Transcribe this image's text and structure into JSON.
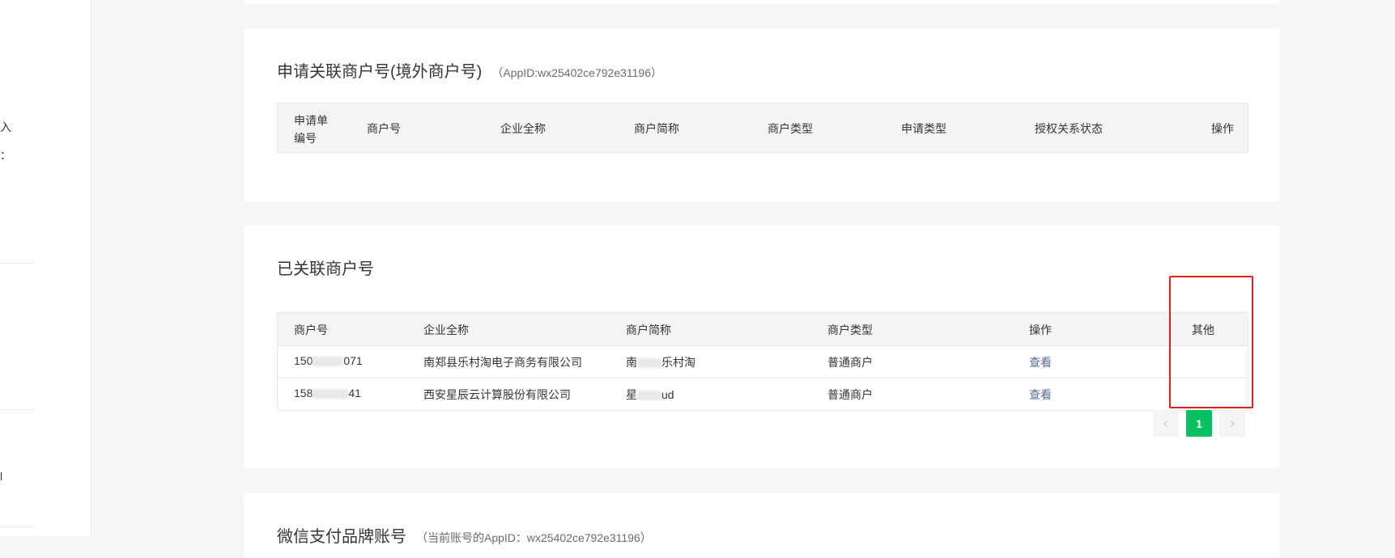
{
  "left_nav": {
    "fragments": [
      "入",
      "：",
      "l"
    ]
  },
  "apply_section": {
    "title": "申请关联商户号(境外商户号)",
    "appid_note": "（AppID:wx25402ce792e31196）",
    "columns": [
      "申请单\n编号",
      "商户号",
      "企业全称",
      "商户简称",
      "商户类型",
      "申请类型",
      "授权关系状态",
      "操作"
    ]
  },
  "linked_section": {
    "title": "已关联商户号",
    "columns": [
      "商户号",
      "企业全称",
      "商户简称",
      "商户类型",
      "操作",
      "其他"
    ],
    "rows": [
      {
        "merchant_id_prefix": "150",
        "merchant_id_suffix": "071",
        "company_name": "南郑县乐村淘电子商务有限公司",
        "short_name_prefix": "南",
        "short_name_suffix": "乐村淘",
        "merchant_type": "普通商户",
        "action": "查看",
        "other": ""
      },
      {
        "merchant_id_prefix": "158",
        "merchant_id_suffix": "41",
        "company_name": "西安星辰云计算股份有限公司",
        "short_name_prefix": "星",
        "short_name_suffix": "ud",
        "merchant_type": "普通商户",
        "action": "查看",
        "other": ""
      }
    ],
    "pagination": {
      "prev_icon": "chevron-left",
      "current_page": "1",
      "next_icon": "chevron-right"
    }
  },
  "brand_section": {
    "title": "微信支付品牌账号",
    "appid_note": "（当前账号的AppID：wx25402ce792e31196）"
  },
  "colors": {
    "accent_green": "#07c160",
    "link_blue": "#576b95",
    "highlight_red": "#e0201a"
  }
}
